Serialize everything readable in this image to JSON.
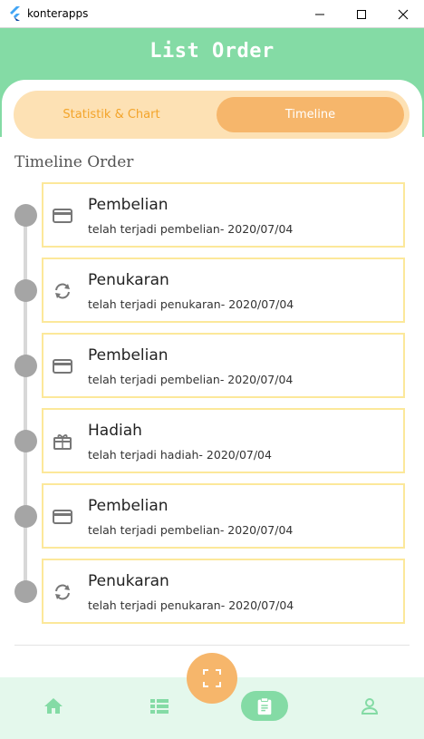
{
  "window": {
    "title": "konterapps",
    "minimize": "—",
    "maximize": "☐",
    "close": "✕"
  },
  "header": {
    "title": "List Order"
  },
  "tabs": [
    {
      "label": "Statistik & Chart",
      "active": false
    },
    {
      "label": "Timeline",
      "active": true
    }
  ],
  "section_title": "Timeline Order",
  "timeline": [
    {
      "name": "Pembelian",
      "desc": "telah terjadi pembelian- 2020/07/04",
      "icon": "credit-card-icon"
    },
    {
      "name": "Penukaran",
      "desc": "telah terjadi penukaran- 2020/07/04",
      "icon": "exchange-icon"
    },
    {
      "name": "Pembelian",
      "desc": "telah terjadi pembelian- 2020/07/04",
      "icon": "credit-card-icon"
    },
    {
      "name": "Hadiah",
      "desc": "telah terjadi hadiah- 2020/07/04",
      "icon": "gift-icon"
    },
    {
      "name": "Pembelian",
      "desc": "telah terjadi pembelian- 2020/07/04",
      "icon": "credit-card-icon"
    },
    {
      "name": "Penukaran",
      "desc": "telah terjadi penukaran- 2020/07/04",
      "icon": "exchange-icon"
    }
  ],
  "bottom_nav": [
    {
      "name": "home-icon",
      "active": false
    },
    {
      "name": "list-icon",
      "active": false
    },
    {
      "name": "clipboard-icon",
      "active": true
    },
    {
      "name": "person-icon",
      "active": false
    }
  ],
  "fab": {
    "icon": "scan-icon"
  },
  "colors": {
    "header": "#84dba5",
    "tab_track": "#fde1b4",
    "tab_active": "#f6b66b",
    "tab_inactive_text": "#f3a42a",
    "item_border": "#fce89a",
    "timeline_dot": "#a5a5a5",
    "bottom_bar": "#e4f8ec",
    "nav_icon": "#84dba5"
  }
}
